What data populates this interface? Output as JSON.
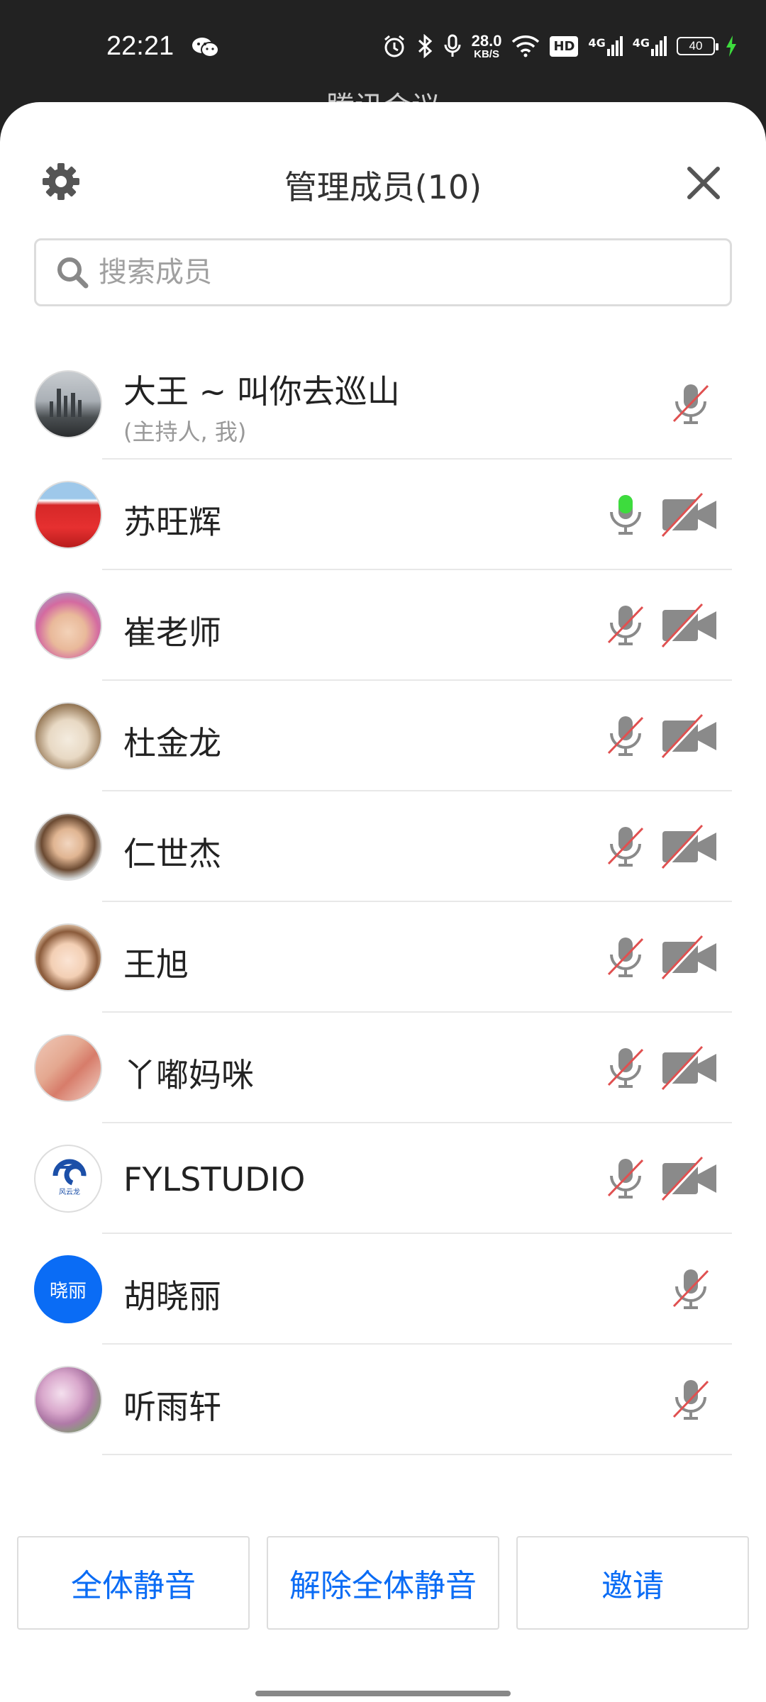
{
  "status_bar": {
    "time": "22:21",
    "net_speed_value": "28.0",
    "net_speed_unit": "KB/S",
    "hd_label": "HD",
    "signal1_label": "4G",
    "signal2_label": "4G",
    "battery": "40",
    "icons": [
      "wechat-icon",
      "alarm-icon",
      "bluetooth-icon",
      "mic-icon",
      "wifi-icon",
      "hd-icon",
      "signal-icon",
      "signal-icon",
      "battery-icon",
      "charging-icon"
    ]
  },
  "behind_title": "腾讯会议",
  "header": {
    "title": "管理成员(10)"
  },
  "search": {
    "placeholder": "搜索成员"
  },
  "members": [
    {
      "name": "大王 ~ 叫你去巡山",
      "sub": "(主持人, 我)",
      "mic": "muted",
      "cam": null
    },
    {
      "name": "苏旺辉",
      "sub": "",
      "mic": "active",
      "cam": "off"
    },
    {
      "name": "崔老师",
      "sub": "",
      "mic": "muted",
      "cam": "off"
    },
    {
      "name": "杜金龙",
      "sub": "",
      "mic": "muted",
      "cam": "off"
    },
    {
      "name": "仁世杰",
      "sub": "",
      "mic": "muted",
      "cam": "off"
    },
    {
      "name": "王旭",
      "sub": "",
      "mic": "muted",
      "cam": "off"
    },
    {
      "name": "丫嘟妈咪",
      "sub": "",
      "mic": "muted",
      "cam": "off"
    },
    {
      "name": "FYLSTUDIO",
      "sub": "",
      "mic": "muted",
      "cam": "off",
      "avatar_text": "风云龙"
    },
    {
      "name": "胡晓丽",
      "sub": "",
      "mic": "muted",
      "cam": null,
      "avatar_text": "晓丽"
    },
    {
      "name": "听雨轩",
      "sub": "",
      "mic": "muted",
      "cam": null
    }
  ],
  "actions": {
    "mute_all": "全体静音",
    "unmute_all": "解除全体静音",
    "invite": "邀请"
  },
  "colors": {
    "accent": "#0a6cf5",
    "muted_slash": "#e05050",
    "active_mic": "#3ddc3d",
    "icon_gray": "#8a8a8a"
  }
}
